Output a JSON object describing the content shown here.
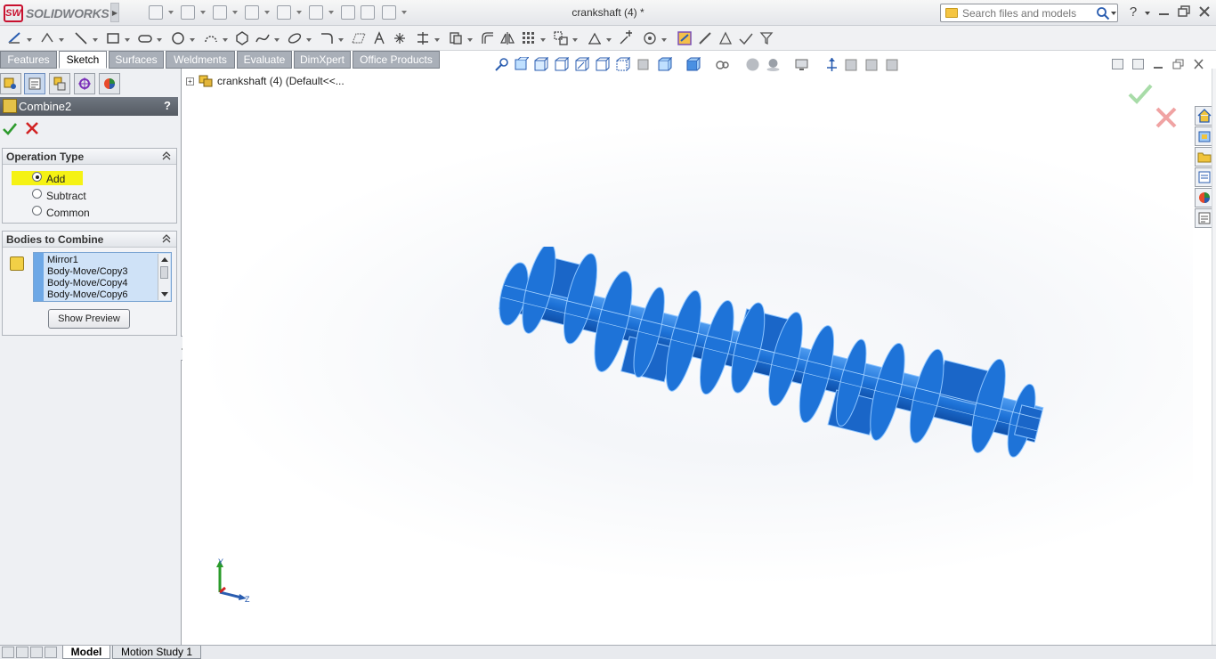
{
  "app": {
    "logo_text": "SOLIDWORKS",
    "logo_mark": "SW"
  },
  "title_bar": {
    "document_title": "crankshaft (4) *",
    "search_placeholder": "Search files and models",
    "help_label": "?"
  },
  "command_tabs": [
    {
      "label": "Features",
      "active": false
    },
    {
      "label": "Sketch",
      "active": true
    },
    {
      "label": "Surfaces",
      "active": false
    },
    {
      "label": "Weldments",
      "active": false
    },
    {
      "label": "Evaluate",
      "active": false
    },
    {
      "label": "DimXpert",
      "active": false
    },
    {
      "label": "Office Products",
      "active": false
    }
  ],
  "property_manager": {
    "title": "Combine2",
    "help": "?",
    "operation_type": {
      "header": "Operation Type",
      "options": [
        "Add",
        "Subtract",
        "Common"
      ],
      "selected": "Add"
    },
    "bodies_to_combine": {
      "header": "Bodies to Combine",
      "items": [
        "Mirror1",
        "Body-Move/Copy3",
        "Body-Move/Copy4",
        "Body-Move/Copy6"
      ],
      "show_preview_label": "Show Preview"
    }
  },
  "feature_tree": {
    "root_label": "crankshaft (4)  (Default<<..."
  },
  "bottom_tabs": [
    {
      "label": "Model",
      "active": true
    },
    {
      "label": "Motion Study 1",
      "active": false
    }
  ],
  "triad": {
    "y_label": "Y",
    "z_label": "Z"
  },
  "colors": {
    "model_blue": "#1e73d8",
    "model_edge": "#8cc4ff",
    "highlight_yellow": "#f5f214",
    "accept_green": "#2e9b2e",
    "reject_red": "#d12323"
  }
}
